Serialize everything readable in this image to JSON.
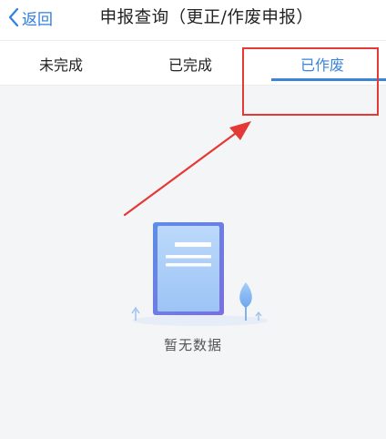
{
  "navbar": {
    "back_label": "返回",
    "title": "申报查询（更正/作废申报）"
  },
  "tabs": [
    {
      "label": "未完成",
      "active": false
    },
    {
      "label": "已完成",
      "active": false
    },
    {
      "label": "已作废",
      "active": true
    }
  ],
  "empty_state": {
    "text": "暂无数据",
    "icon": "empty-document-icon"
  },
  "colors": {
    "accent": "#3a84d9",
    "back_link": "#2f7fe0",
    "annotation_red": "#e53935",
    "background": "#f4f5f7"
  }
}
